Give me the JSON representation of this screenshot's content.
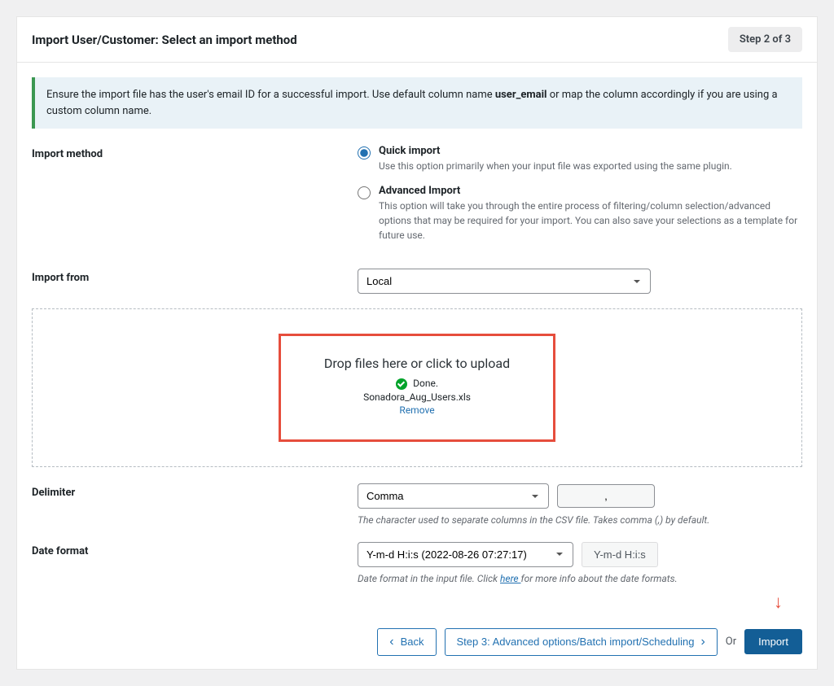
{
  "header": {
    "title": "Import User/Customer: Select an import method",
    "step_badge": "Step 2 of 3"
  },
  "notice": {
    "pre": "Ensure the import file has the user's email ID for a successful import. Use default column name ",
    "bold": "user_email",
    "post": " or map the column accordingly if you are using a custom column name."
  },
  "import_method": {
    "label": "Import method",
    "quick": {
      "title": "Quick import",
      "desc": "Use this option primarily when your input file was exported using the same plugin."
    },
    "advanced": {
      "title": "Advanced Import",
      "desc": "This option will take you through the entire process of filtering/column selection/advanced options that may be required for your import. You can also save your selections as a template for future use."
    }
  },
  "import_from": {
    "label": "Import from",
    "selected": "Local"
  },
  "dropzone": {
    "title": "Drop files here or click to upload",
    "done": "Done.",
    "file": "Sonadora_Aug_Users.xls",
    "remove": "Remove"
  },
  "delimiter": {
    "label": "Delimiter",
    "selected": "Comma",
    "value": ",",
    "help": "The character used to separate columns in the CSV file. Takes comma (,) by default."
  },
  "date_format": {
    "label": "Date format",
    "selected": "Y-m-d H:i:s (2022-08-26 07:27:17)",
    "button": "Y-m-d H:i:s",
    "help_pre": "Date format in the input file. Click ",
    "help_link": "here ",
    "help_post": "for more info about the date formats."
  },
  "footer": {
    "back": "Back",
    "step3": "Step 3: Advanced options/Batch import/Scheduling",
    "or": "Or",
    "import": "Import"
  }
}
